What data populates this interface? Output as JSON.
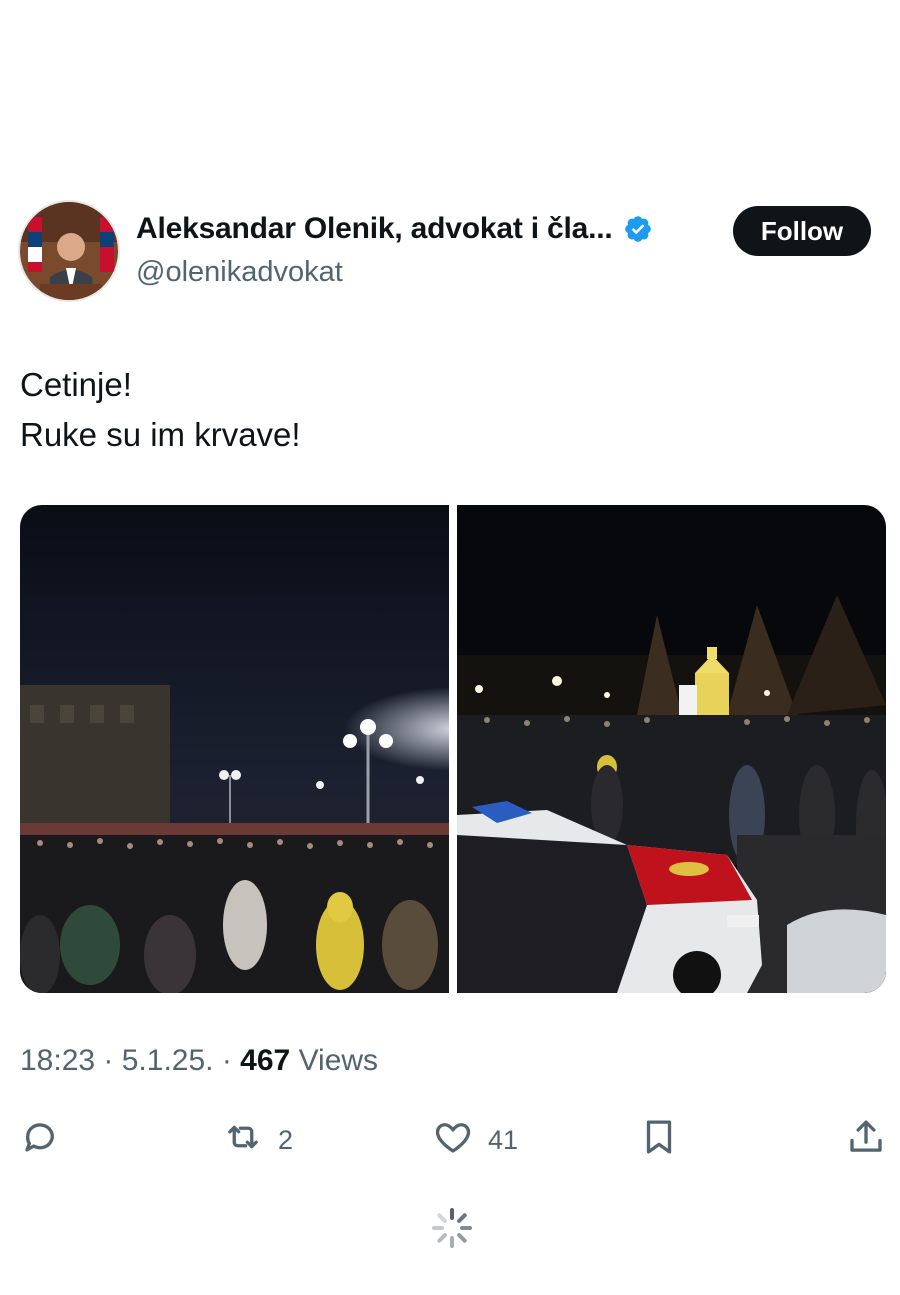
{
  "author": {
    "name": "Aleksandar Olenik, advokat i čla...",
    "handle": "@olenikadvokat",
    "verified_icon": "verified-badge-icon",
    "follow_label": "Follow"
  },
  "tweet": {
    "lines": [
      "Cetinje!",
      "Ruke su im krvave!"
    ]
  },
  "meta": {
    "time": "18:23",
    "sep1": " · ",
    "date": "5.1.25.",
    "sep2": " · ",
    "views_count": "467",
    "views_label": " Views"
  },
  "actions": {
    "reply": {
      "icon": "reply-icon",
      "count": ""
    },
    "retweet": {
      "icon": "retweet-icon",
      "count": "2"
    },
    "like": {
      "icon": "heart-icon",
      "count": "41"
    },
    "bookmark": {
      "icon": "bookmark-icon"
    },
    "share": {
      "icon": "share-icon"
    }
  },
  "colors": {
    "accent": "#1d9bf0",
    "text": "#0f1419",
    "muted": "#536471",
    "follow_bg": "#0f1419"
  }
}
